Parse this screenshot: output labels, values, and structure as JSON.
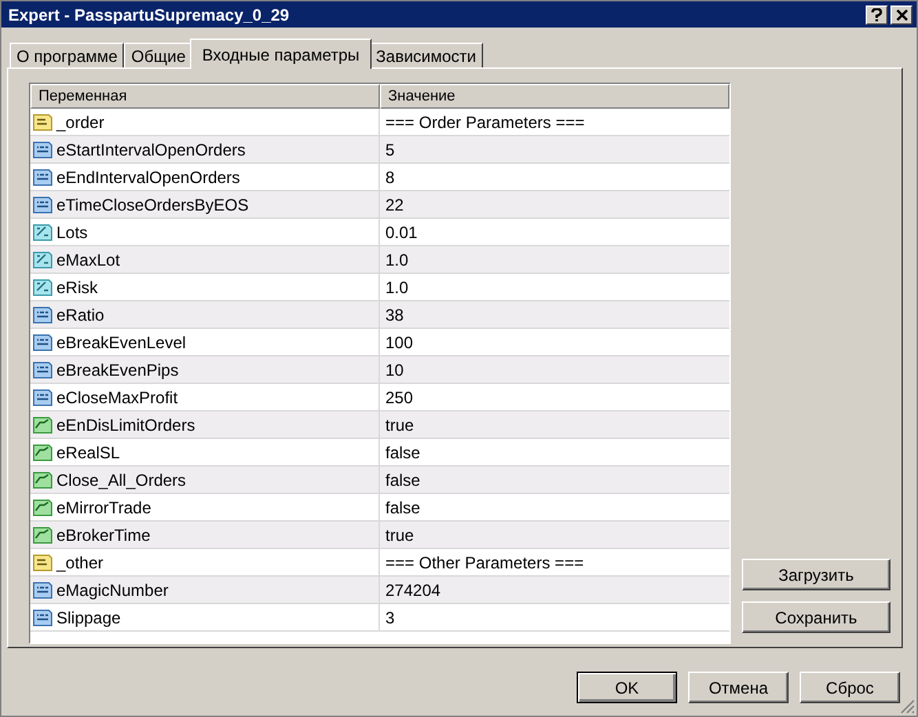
{
  "window": {
    "title": "Expert - PasspartuSupremacy_0_29"
  },
  "tabs": [
    {
      "label": "О программе",
      "selected": false
    },
    {
      "label": "Общие",
      "selected": false
    },
    {
      "label": "Входные параметры",
      "selected": true
    },
    {
      "label": "Зависимости",
      "selected": false
    }
  ],
  "table": {
    "columns": [
      "Переменная",
      "Значение"
    ],
    "rows": [
      {
        "kind": "string",
        "name": "_order",
        "value": "=== Order Parameters ==="
      },
      {
        "kind": "int",
        "name": "eStartIntervalOpenOrders",
        "value": "5"
      },
      {
        "kind": "int",
        "name": "eEndIntervalOpenOrders",
        "value": "8"
      },
      {
        "kind": "int",
        "name": "eTimeCloseOrdersByEOS",
        "value": "22"
      },
      {
        "kind": "double",
        "name": "Lots",
        "value": "0.01"
      },
      {
        "kind": "double",
        "name": "eMaxLot",
        "value": "1.0"
      },
      {
        "kind": "double",
        "name": "eRisk",
        "value": "1.0"
      },
      {
        "kind": "int",
        "name": "eRatio",
        "value": "38"
      },
      {
        "kind": "int",
        "name": "eBreakEvenLevel",
        "value": "100"
      },
      {
        "kind": "int",
        "name": "eBreakEvenPips",
        "value": "10"
      },
      {
        "kind": "int",
        "name": "eCloseMaxProfit",
        "value": "250"
      },
      {
        "kind": "bool",
        "name": "eEnDisLimitOrders",
        "value": "true"
      },
      {
        "kind": "bool",
        "name": "eRealSL",
        "value": "false"
      },
      {
        "kind": "bool",
        "name": "Close_All_Orders",
        "value": "false"
      },
      {
        "kind": "bool",
        "name": "eMirrorTrade",
        "value": "false"
      },
      {
        "kind": "bool",
        "name": "eBrokerTime",
        "value": "true"
      },
      {
        "kind": "string",
        "name": "_other",
        "value": "=== Other Parameters ==="
      },
      {
        "kind": "int",
        "name": "eMagicNumber",
        "value": "274204"
      },
      {
        "kind": "int",
        "name": "Slippage",
        "value": "3"
      }
    ]
  },
  "side_buttons": [
    "Загрузить",
    "Сохранить"
  ],
  "buttons": [
    "OK",
    "Отмена",
    "Сброс"
  ]
}
